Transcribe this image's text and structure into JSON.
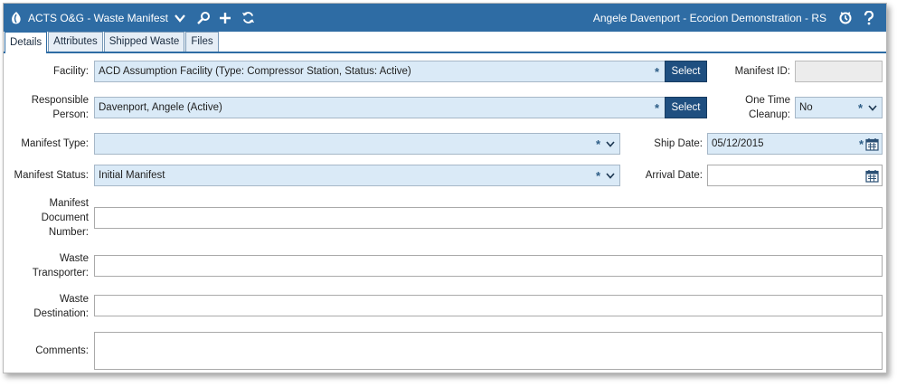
{
  "header": {
    "app_title": "ACTS O&G - Waste Manifest",
    "user_info": "Angele Davenport  -  Ecocion Demonstration - RS"
  },
  "tabs": [
    {
      "label": "Details",
      "active": true
    },
    {
      "label": "Attributes"
    },
    {
      "label": "Shipped Waste"
    },
    {
      "label": "Files"
    }
  ],
  "form": {
    "facility": {
      "label": "Facility:",
      "value": "ACD Assumption Facility (Type: Compressor Station, Status: Active)",
      "button": "Select"
    },
    "responsible_person": {
      "label_line1": "Responsible",
      "label_line2": "Person:",
      "value": "Davenport, Angele (Active)",
      "button": "Select"
    },
    "manifest_type": {
      "label": "Manifest Type:",
      "value": ""
    },
    "manifest_status": {
      "label": "Manifest Status:",
      "value": "Initial Manifest"
    },
    "manifest_document_number": {
      "label_line1": "Manifest",
      "label_line2": "Document",
      "label_line3": "Number:",
      "value": ""
    },
    "waste_transporter": {
      "label_line1": "Waste",
      "label_line2": "Transporter:",
      "value": ""
    },
    "waste_destination": {
      "label_line1": "Waste",
      "label_line2": "Destination:",
      "value": ""
    },
    "comments": {
      "label": "Comments:",
      "value": ""
    },
    "manifest_id": {
      "label": "Manifest ID:",
      "value": ""
    },
    "one_time_cleanup": {
      "label_line1": "One Time",
      "label_line2": "Cleanup:",
      "value": "No"
    },
    "ship_date": {
      "label": "Ship Date:",
      "value": "05/12/2015"
    },
    "arrival_date": {
      "label": "Arrival Date:",
      "value": ""
    }
  },
  "required_marker": "*",
  "colors": {
    "header_bg": "#2e6ca4",
    "field_bg": "#daeaf7",
    "button_bg": "#1f4f80"
  }
}
